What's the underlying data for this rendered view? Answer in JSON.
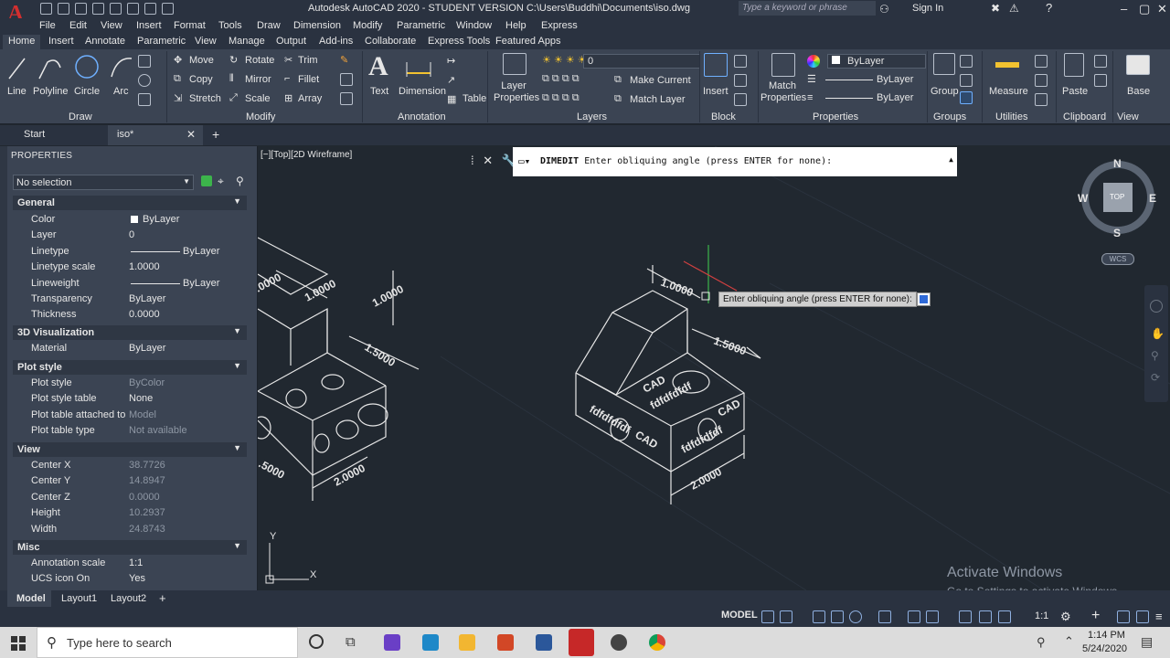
{
  "titlebar": {
    "title": "Autodesk AutoCAD 2020 - STUDENT VERSION    C:\\Users\\Buddhi\\Documents\\iso.dwg",
    "search_placeholder": "Type a keyword or phrase",
    "signin": "Sign In"
  },
  "menu": [
    "File",
    "Edit",
    "View",
    "Insert",
    "Format",
    "Tools",
    "Draw",
    "Dimension",
    "Modify",
    "Parametric",
    "Window",
    "Help",
    "Express"
  ],
  "ribbon_tabs": [
    "Home",
    "Insert",
    "Annotate",
    "Parametric",
    "View",
    "Manage",
    "Output",
    "Add-ins",
    "Collaborate",
    "Express Tools",
    "Featured Apps"
  ],
  "ribbon": {
    "draw": {
      "line": "Line",
      "polyline": "Polyline",
      "circle": "Circle",
      "arc": "Arc",
      "panel": "Draw"
    },
    "modify": {
      "move": "Move",
      "rotate": "Rotate",
      "trim": "Trim",
      "copy": "Copy",
      "mirror": "Mirror",
      "fillet": "Fillet",
      "stretch": "Stretch",
      "scale": "Scale",
      "array": "Array",
      "panel": "Modify"
    },
    "annotation": {
      "text": "Text",
      "dimension": "Dimension",
      "table": "Table",
      "panel": "Annotation"
    },
    "layers": {
      "layer_properties": "Layer Properties",
      "current_layer": "0",
      "make_current": "Make Current",
      "match_layer": "Match Layer",
      "panel": "Layers"
    },
    "block": {
      "insert": "Insert",
      "panel": "Block"
    },
    "properties": {
      "match_properties": "Match Properties",
      "color": "ByLayer",
      "linetype": "ByLayer",
      "lineweight": "ByLayer",
      "panel": "Properties"
    },
    "groups": {
      "group": "Group",
      "panel": "Groups"
    },
    "utilities": {
      "measure": "Measure",
      "panel": "Utilities"
    },
    "clipboard": {
      "paste": "Paste",
      "panel": "Clipboard"
    },
    "view": {
      "base": "Base",
      "panel": "View"
    }
  },
  "file_tabs": {
    "start": "Start",
    "current": "iso*"
  },
  "properties": {
    "title": "PROPERTIES",
    "selection": "No selection",
    "sections": {
      "general": "General",
      "viz3d": "3D Visualization",
      "plot": "Plot style",
      "view": "View",
      "misc": "Misc"
    },
    "general": [
      {
        "k": "Color",
        "v": "ByLayer"
      },
      {
        "k": "Layer",
        "v": "0"
      },
      {
        "k": "Linetype",
        "v": "ByLayer"
      },
      {
        "k": "Linetype scale",
        "v": "1.0000"
      },
      {
        "k": "Lineweight",
        "v": "ByLayer"
      },
      {
        "k": "Transparency",
        "v": "ByLayer"
      },
      {
        "k": "Thickness",
        "v": "0.0000"
      }
    ],
    "viz3d": [
      {
        "k": "Material",
        "v": "ByLayer"
      }
    ],
    "plot": [
      {
        "k": "Plot style",
        "v": "ByColor"
      },
      {
        "k": "Plot style table",
        "v": "None"
      },
      {
        "k": "Plot table attached to",
        "v": "Model"
      },
      {
        "k": "Plot table type",
        "v": "Not available"
      }
    ],
    "view": [
      {
        "k": "Center X",
        "v": "38.7726"
      },
      {
        "k": "Center Y",
        "v": "14.8947"
      },
      {
        "k": "Center Z",
        "v": "0.0000"
      },
      {
        "k": "Height",
        "v": "10.2937"
      },
      {
        "k": "Width",
        "v": "24.8743"
      }
    ],
    "misc": [
      {
        "k": "Annotation scale",
        "v": "1:1"
      },
      {
        "k": "UCS icon On",
        "v": "Yes"
      }
    ]
  },
  "viewport": {
    "label": "[−][Top][2D Wireframe]",
    "command_name": "DIMEDIT",
    "command_prompt": "Enter obliquing angle (press ENTER for none):",
    "tooltip": "Enter obliquing angle (press ENTER for none):",
    "viewcube": {
      "n": "N",
      "s": "S",
      "e": "E",
      "w": "W",
      "face": "TOP"
    },
    "wcs": "WCS",
    "ucs_x": "X",
    "ucs_y": "Y"
  },
  "drawing": {
    "left_dims": {
      "d1": "1.0000",
      "d2": "1.0000",
      "d3": "1.5000",
      "d4": "2.0000",
      "d5": ".0000",
      "d6": ".5000"
    },
    "right_dims": {
      "d1": "1.0000",
      "d2": "1.5000",
      "d3": "2.0000"
    },
    "texts": {
      "cad1": "CAD",
      "cad2": "CAD",
      "cad3": "CAD",
      "f1": "fdfdfdfdf",
      "f2": "fdfdfdfdf",
      "f3": "fdfdfdfdf"
    }
  },
  "watermark": {
    "line1": "Activate Windows",
    "line2": "Go to Settings to activate Windows."
  },
  "layout_tabs": [
    "Model",
    "Layout1",
    "Layout2"
  ],
  "status": {
    "model": "MODEL",
    "scale": "1:1"
  },
  "taskbar": {
    "search": "Type here to search",
    "time": "1:14 PM",
    "date": "5/24/2020"
  }
}
